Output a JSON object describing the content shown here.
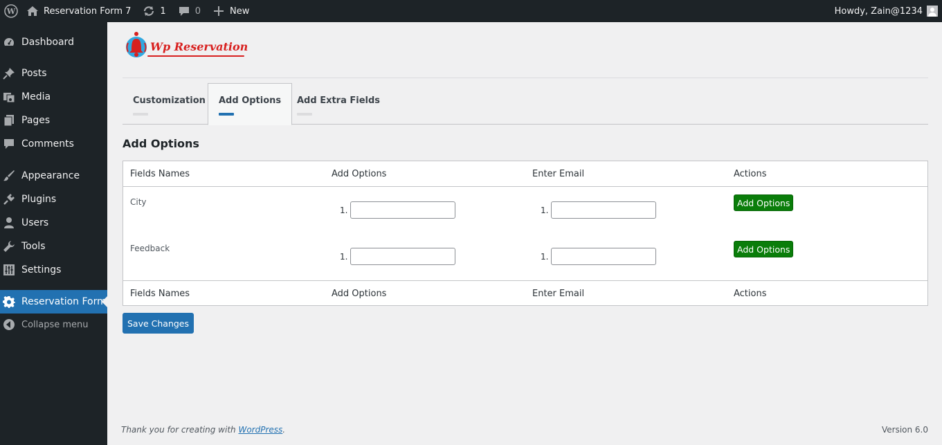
{
  "admin_bar": {
    "site_name": "Reservation Form 7",
    "updates_count": "1",
    "comments_count": "0",
    "new_label": "New",
    "howdy": "Howdy, Zain@1234"
  },
  "sidebar": {
    "items": [
      {
        "label": "Dashboard",
        "icon": "dashboard-icon"
      },
      {
        "label": "Posts",
        "icon": "pushpin-icon"
      },
      {
        "label": "Media",
        "icon": "media-icon"
      },
      {
        "label": "Pages",
        "icon": "pages-icon"
      },
      {
        "label": "Comments",
        "icon": "comment-icon"
      },
      {
        "label": "Appearance",
        "icon": "paintbrush-icon"
      },
      {
        "label": "Plugins",
        "icon": "plug-icon"
      },
      {
        "label": "Users",
        "icon": "user-icon"
      },
      {
        "label": "Tools",
        "icon": "wrench-icon"
      },
      {
        "label": "Settings",
        "icon": "sliders-icon"
      },
      {
        "label": "Reservation Form",
        "icon": "gear-icon"
      }
    ],
    "collapse_label": "Collapse menu",
    "active_color": "#2271b1"
  },
  "logo": {
    "text": "Wp Reservation",
    "color": "#d8201f"
  },
  "tabs": [
    {
      "label": "Customization"
    },
    {
      "label": "Add Options"
    },
    {
      "label": "Add Extra Fields"
    }
  ],
  "section_title": "Add Options",
  "table": {
    "headers": [
      "Fields Names",
      "Add Options",
      "Enter Email",
      "Actions"
    ],
    "rows": [
      {
        "name": "City",
        "option_index": "1.",
        "option_value": "",
        "email_index": "1.",
        "email_value": "",
        "action_label": "Add Options"
      },
      {
        "name": "Feedback",
        "option_index": "1.",
        "option_value": "",
        "email_index": "1.",
        "email_value": "",
        "action_label": "Add Options"
      }
    ]
  },
  "save_label": "Save Changes",
  "footer": {
    "thanks_prefix": "Thank you for creating with ",
    "link_text": "WordPress",
    "thanks_suffix": ".",
    "version": "Version 6.0"
  },
  "colors": {
    "green_button": "#0a7d0a",
    "primary": "#2271b1",
    "adminbar": "#1d2327"
  }
}
